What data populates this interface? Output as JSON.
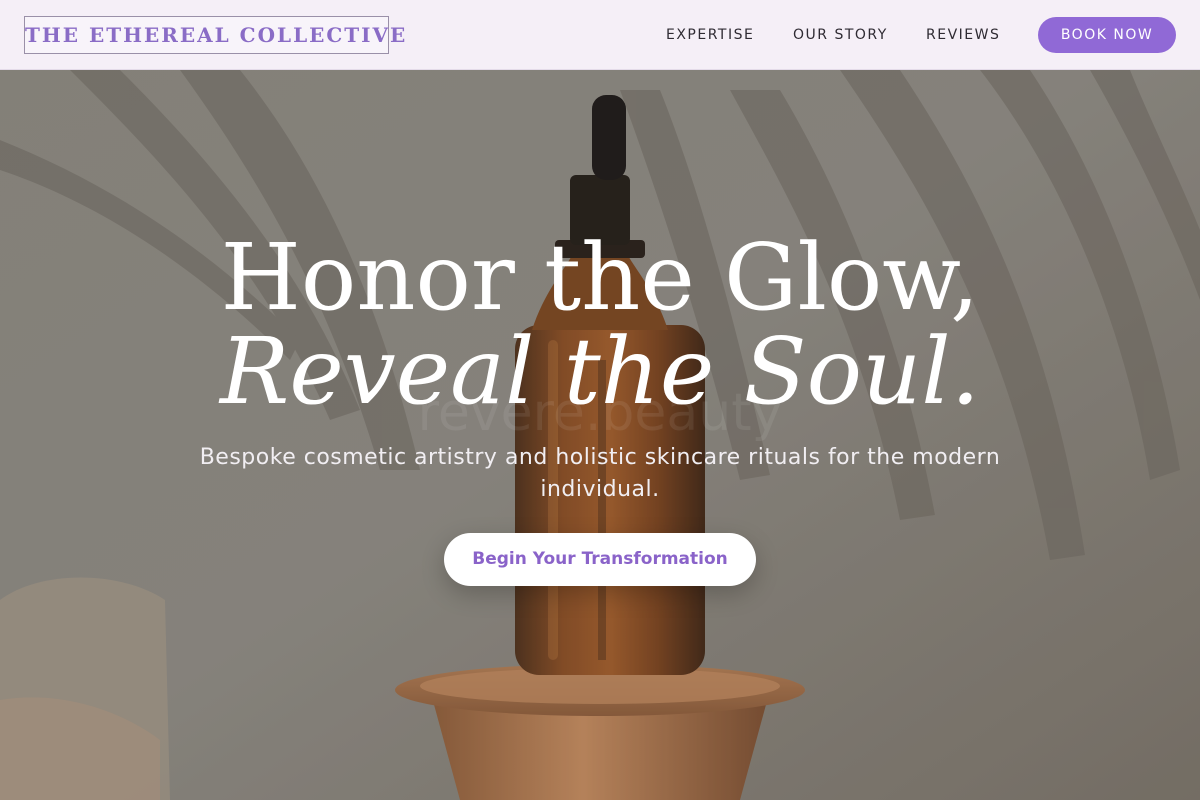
{
  "header": {
    "logo_text": "THE ETHEREAL COLLECTIVE",
    "nav": [
      {
        "label": "EXPERTISE"
      },
      {
        "label": "OUR STORY"
      },
      {
        "label": "REVIEWS"
      }
    ],
    "book_label": "BOOK NOW"
  },
  "hero": {
    "headline_line1": "Honor the Glow,",
    "headline_line2": "Reveal the Soul.",
    "watermark": "revere.beauty",
    "subtitle": "Bespoke cosmetic artistry and holistic skincare rituals for the modern individual.",
    "cta_label": "Begin Your Transformation",
    "image_subject": "amber dropper serum bottle on wooden pedestal with palm leaf shadows"
  },
  "colors": {
    "accent": "#9069d6",
    "logo_text": "#8a6cc6",
    "header_bg": "#f5eff7",
    "cta_text": "#8a63c9",
    "hero_overlay": "#7d786f"
  }
}
